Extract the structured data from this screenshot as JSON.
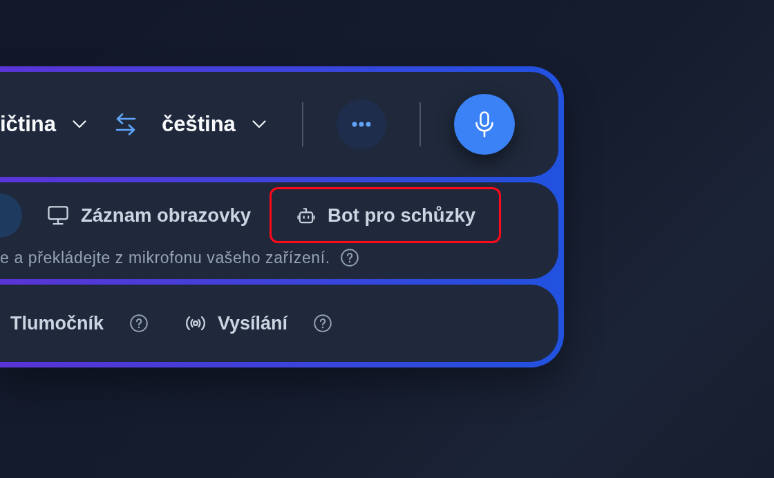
{
  "language_bar": {
    "source_language": "ičtina",
    "target_language": "čeština"
  },
  "capture_modes": {
    "tabs": [
      {
        "kind": "clipped",
        "selected": true,
        "highlighted": false
      },
      {
        "kind": "full",
        "label": "Záznam obrazovky",
        "selected": false,
        "highlighted": false
      },
      {
        "kind": "full",
        "label": "Bot pro schůzky",
        "selected": false,
        "highlighted": true
      }
    ],
    "description": "e a překládejte z mikrofonu vašeho zařízení."
  },
  "features": [
    {
      "label": "Tlumočník"
    },
    {
      "label": "Vysílání"
    }
  ]
}
